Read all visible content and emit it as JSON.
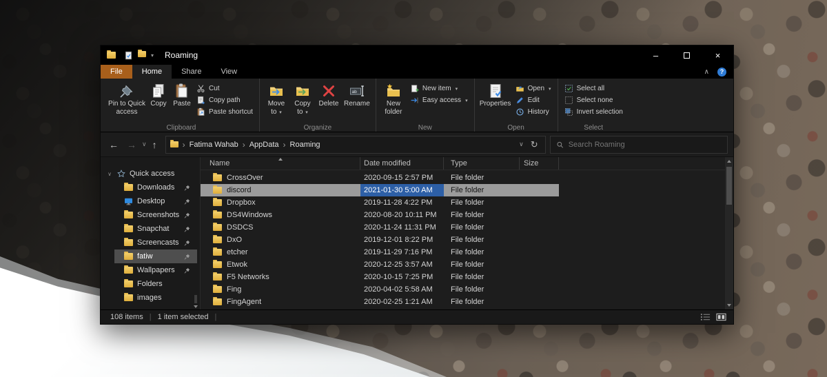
{
  "icons": {
    "back": "←",
    "forward": "→",
    "up": "↑",
    "dropdown": "∨",
    "refresh": "↻",
    "crumb_sep": "›",
    "caret": "▾",
    "collapse": "∧",
    "help": "?",
    "minimize": "–",
    "close": "×",
    "pipe": "|"
  },
  "window": {
    "title": "Roaming"
  },
  "ribbon": {
    "tabs": [
      "File",
      "Home",
      "Share",
      "View"
    ],
    "clipboard": {
      "label": "Clipboard",
      "pin": "Pin to Quick access",
      "copy": "Copy",
      "paste": "Paste",
      "cut": "Cut",
      "copy_path": "Copy path",
      "paste_shortcut": "Paste shortcut"
    },
    "organize": {
      "label": "Organize",
      "move_to": "Move to",
      "copy_to": "Copy to",
      "delete": "Delete",
      "rename": "Rename"
    },
    "new": {
      "label": "New",
      "new_folder": "New folder",
      "new_item": "New item",
      "easy_access": "Easy access"
    },
    "open": {
      "label": "Open",
      "properties": "Properties",
      "open": "Open",
      "edit": "Edit",
      "history": "History"
    },
    "select": {
      "label": "Select",
      "select_all": "Select all",
      "select_none": "Select none",
      "invert_selection": "Invert selection"
    }
  },
  "address_bar": {
    "breadcrumb": [
      "Fatima Wahab",
      "AppData",
      "Roaming"
    ],
    "search_placeholder": "Search Roaming"
  },
  "sidebar": {
    "items": [
      {
        "label": "Quick access",
        "icon": "star",
        "root": true,
        "pinned": false,
        "selected": false
      },
      {
        "label": "Downloads",
        "icon": "folder",
        "root": false,
        "pinned": true,
        "selected": false
      },
      {
        "label": "Desktop",
        "icon": "desktop",
        "root": false,
        "pinned": true,
        "selected": false
      },
      {
        "label": "Screenshots",
        "icon": "folder",
        "root": false,
        "pinned": true,
        "selected": false
      },
      {
        "label": "Snapchat",
        "icon": "folder",
        "root": false,
        "pinned": true,
        "selected": false
      },
      {
        "label": "Screencasts",
        "icon": "folder",
        "root": false,
        "pinned": true,
        "selected": false
      },
      {
        "label": "fatiw",
        "icon": "folder",
        "root": false,
        "pinned": true,
        "selected": true
      },
      {
        "label": "Wallpapers",
        "icon": "folder",
        "root": false,
        "pinned": true,
        "selected": false
      },
      {
        "label": "Folders",
        "icon": "folder",
        "root": false,
        "pinned": false,
        "selected": false
      },
      {
        "label": "images",
        "icon": "folder",
        "root": false,
        "pinned": false,
        "selected": false
      }
    ]
  },
  "file_list": {
    "columns": [
      "Name",
      "Date modified",
      "Type",
      "Size"
    ],
    "rows": [
      {
        "name": "CrossOver",
        "date": "2020-09-15 2:57 PM",
        "type": "File folder",
        "size": "",
        "selected": false
      },
      {
        "name": "discord",
        "date": "2021-01-30 5:00 AM",
        "type": "File folder",
        "size": "",
        "selected": true
      },
      {
        "name": "Dropbox",
        "date": "2019-11-28 4:22 PM",
        "type": "File folder",
        "size": "",
        "selected": false
      },
      {
        "name": "DS4Windows",
        "date": "2020-08-20 10:11 PM",
        "type": "File folder",
        "size": "",
        "selected": false
      },
      {
        "name": "DSDCS",
        "date": "2020-11-24 11:31 PM",
        "type": "File folder",
        "size": "",
        "selected": false
      },
      {
        "name": "DxO",
        "date": "2019-12-01 8:22 PM",
        "type": "File folder",
        "size": "",
        "selected": false
      },
      {
        "name": "etcher",
        "date": "2019-11-29 7:16 PM",
        "type": "File folder",
        "size": "",
        "selected": false
      },
      {
        "name": "Etwok",
        "date": "2020-12-25 3:57 AM",
        "type": "File folder",
        "size": "",
        "selected": false
      },
      {
        "name": "F5 Networks",
        "date": "2020-10-15 7:25 PM",
        "type": "File folder",
        "size": "",
        "selected": false
      },
      {
        "name": "Fing",
        "date": "2020-04-02 5:58 AM",
        "type": "File folder",
        "size": "",
        "selected": false
      },
      {
        "name": "FingAgent",
        "date": "2020-02-25 1:21 AM",
        "type": "File folder",
        "size": "",
        "selected": false
      }
    ]
  },
  "status_bar": {
    "count": "108 items",
    "selected": "1 item selected"
  }
}
